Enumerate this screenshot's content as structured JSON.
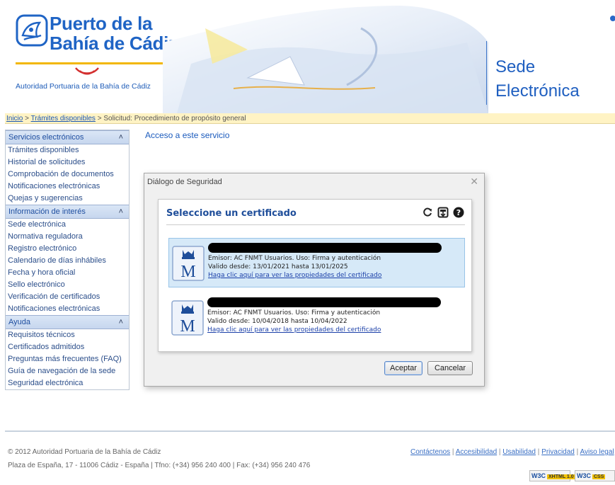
{
  "header": {
    "logo_line1": "Puerto de la",
    "logo_line2": "Bahía de Cádiz",
    "logo_subtitle": "Autoridad Portuaria de la Bahía de Cádiz",
    "site_title_1": "Sede",
    "site_title_2": "Electrónica"
  },
  "breadcrumb": {
    "items": [
      "Inicio",
      "Trámites disponibles"
    ],
    "current": "Solicitud: Procedimiento de propósito general",
    "separator": ">"
  },
  "sidebar": {
    "sections": [
      {
        "title": "Servicios electrónicos",
        "items": [
          "Trámites disponibles",
          "Historial de solicitudes",
          "Comprobación de documentos",
          "Notificaciones electrónicas",
          "Quejas y sugerencias"
        ]
      },
      {
        "title": "Información de interés",
        "items": [
          "Sede electrónica",
          "Normativa reguladora",
          "Registro electrónico",
          "Calendario de días inhábiles",
          "Fecha y hora oficial",
          "Sello electrónico",
          "Verificación de certificados",
          "Notificaciones electrónicas"
        ]
      },
      {
        "title": "Ayuda",
        "items": [
          "Requisitos técnicos",
          "Certificados admitidos",
          "Preguntas más frecuentes (FAQ)",
          "Guía de navegación de la sede",
          "Seguridad electrónica"
        ]
      }
    ]
  },
  "main": {
    "service_title": "Acceso a este servicio"
  },
  "dialog": {
    "title": "Diálogo de Seguridad",
    "close_glyph": "✕",
    "heading": "Seleccione un certificado",
    "certificates": [
      {
        "issuer": "Emisor: AC FNMT Usuarios. Uso: Firma y autenticación",
        "validity": "Valido desde: 13/01/2021 hasta 13/01/2025",
        "link": "Haga clic aquí para ver las propiedades del certificado"
      },
      {
        "issuer": "Emisor: AC FNMT Usuarios. Uso: Firma y autenticación",
        "validity": "Valido desde: 10/04/2018 hasta 10/04/2022",
        "link": "Haga clic aquí para ver las propiedades del certificado"
      }
    ],
    "ok_label": "Aceptar",
    "cancel_label": "Cancelar"
  },
  "footer": {
    "copyright": "© 2012 Autoridad Portuaria de la Bahía de Cádiz",
    "address": "Plaza de España, 17 - 11006 Cádiz - España | Tfno: (+34) 956 240 400 | Fax: (+34) 956 240 476",
    "links": [
      "Contáctenos",
      "Accesibilidad",
      "Usabilidad",
      "Privacidad",
      "Aviso legal"
    ],
    "badge_xhtml": "W3C",
    "badge_xhtml_tag": "XHTML 1.0",
    "badge_css": "W3C",
    "badge_css_tag": "CSS"
  },
  "colors": {
    "brand_blue": "#1f64c5",
    "breadcrumb_bg": "#fff3c4",
    "selected_row": "#d6e9f8"
  }
}
